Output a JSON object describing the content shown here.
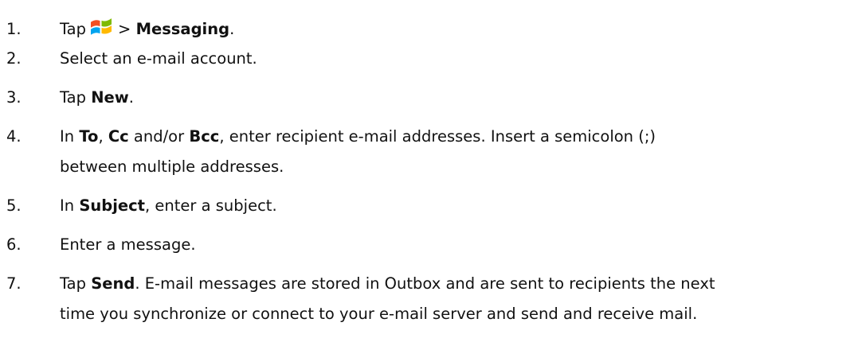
{
  "steps": [
    {
      "number": "1.",
      "before": "Tap",
      "icon": "windows-start-icon",
      "between": ">",
      "bold": "Messaging",
      "after": "."
    },
    {
      "number": "2.",
      "text": "Select an e-mail account."
    },
    {
      "number": "3.",
      "before": "Tap",
      "bold": "New",
      "after": "."
    },
    {
      "number": "4.",
      "before": "In",
      "bold1": "To",
      "sep1": ",",
      "bold2": "Cc",
      "sep2": "and/or",
      "bold3": "Bcc",
      "line1_rest": ", enter recipient e-mail addresses. Insert a semicolon (;)",
      "line2": "between multiple addresses."
    },
    {
      "number": "5.",
      "before": "In",
      "bold": "Subject",
      "after": ", enter a subject."
    },
    {
      "number": "6.",
      "text": "Enter a message."
    },
    {
      "number": "7.",
      "before": "Tap",
      "bold": "Send",
      "line1_rest": ". E-mail messages are stored in Outbox and are sent to recipients the next",
      "line2": "time you synchronize or connect to your e-mail server and send and receive mail."
    }
  ],
  "colors": {
    "text": "#111111",
    "logo_red": "#f25022",
    "logo_green": "#7fba00",
    "logo_blue": "#00a4ef",
    "logo_yellow": "#ffb900"
  }
}
